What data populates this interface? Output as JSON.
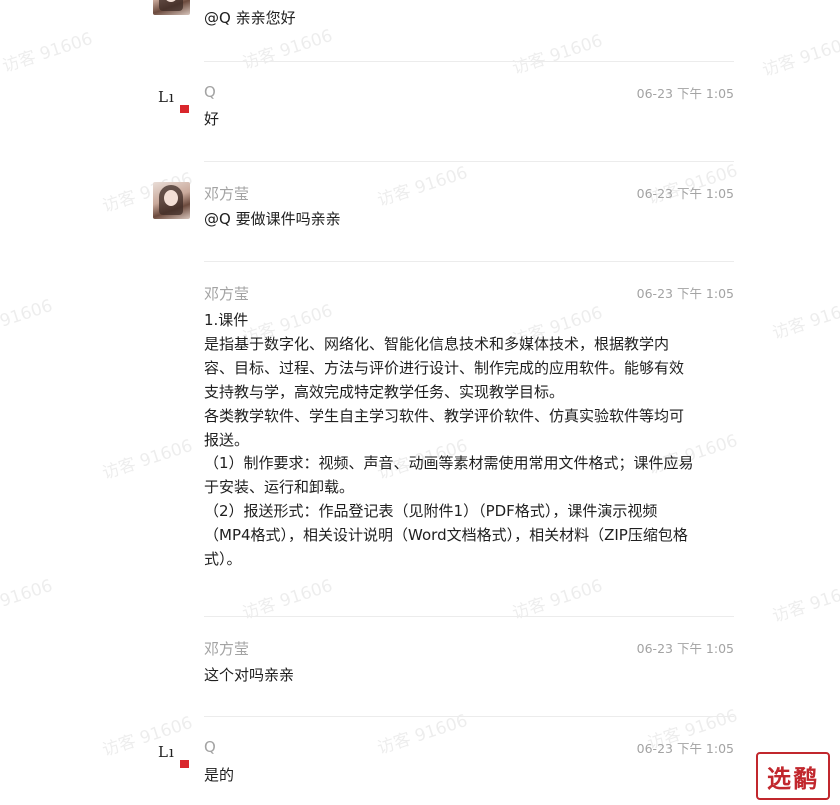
{
  "watermark": "访客 91606",
  "messages": [
    {
      "name": "",
      "time": "",
      "text": "@Q 亲亲您好",
      "avatar": "photo"
    },
    {
      "name": "Q",
      "time": "06-23 下午 1:05",
      "text": "好",
      "avatar": "logo"
    },
    {
      "name": "邓方莹",
      "time": "06-23 下午 1:05",
      "text": "@Q 要做课件吗亲亲",
      "avatar": "photo"
    },
    {
      "name": "邓方莹",
      "time": "06-23 下午 1:05",
      "text": "1.课件\n是指基于数字化、网络化、智能化信息技术和多媒体技术，根据教学内容、目标、过程、方法与评价进行设计、制作完成的应用软件。能够有效支持教与学，高效完成特定教学任务、实现教学目标。\n各类教学软件、学生自主学习软件、教学评价软件、仿真实验软件等均可报送。\n（1）制作要求：视频、声音、动画等素材需使用常用文件格式；课件应易于安装、运行和卸载。\n（2）报送形式：作品登记表（见附件1）（PDF格式），课件演示视频（MP4格式），相关设计说明（Word文档格式），相关材料（ZIP压缩包格式）。",
      "avatar": ""
    },
    {
      "name": "邓方莹",
      "time": "06-23 下午 1:05",
      "text": "这个对吗亲亲",
      "avatar": ""
    },
    {
      "name": "Q",
      "time": "06-23 下午 1:05",
      "text": "是的",
      "avatar": "logo"
    }
  ],
  "corner_badge": "选鹬",
  "colors": {
    "meta": "#a3a3a3",
    "text": "#1f1f1f",
    "separator": "#ececec",
    "flag": "#d9262c",
    "badge": "#c1272d"
  }
}
